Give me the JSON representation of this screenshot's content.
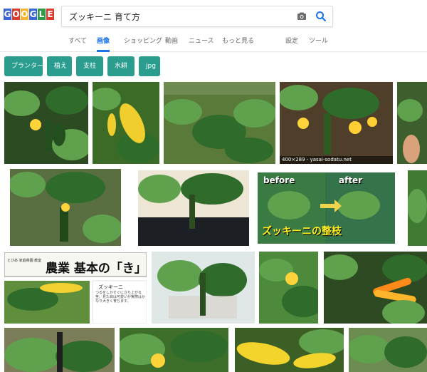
{
  "header": {
    "logo_letters": [
      "G",
      "O",
      "O",
      "G",
      "L",
      "E"
    ],
    "search_value": "ズッキーニ 育て方",
    "tabs": [
      {
        "label": "すべて",
        "active": false
      },
      {
        "label": "画像",
        "active": true
      },
      {
        "label": "ショッピング",
        "active": false
      },
      {
        "label": "動画",
        "active": false
      },
      {
        "label": "ニュース",
        "active": false
      },
      {
        "label": "もっと見る",
        "active": false
      },
      {
        "label": "設定",
        "active": false
      },
      {
        "label": "ツール",
        "active": false
      }
    ]
  },
  "chips": [
    "プランター",
    "植え",
    "支柱",
    "水耕",
    "jpg"
  ],
  "images": {
    "img_03_caption": "400×289 - yasai-sodatu.net",
    "before_label": "before",
    "after_label": "after",
    "pruning_title": "ズッキーニの整枝",
    "farm_label_small": "とびあ 家庭菜園 教室",
    "farm_title": "農業 基本の「き」",
    "zucchini_label": "ズッキーニ",
    "zucchini_desc": "つるをしかすぐに立ち上がる茎。見た目は可愛いが実際はかなり大きく育ちます。"
  },
  "colors": {
    "accent_blue": "#1a73e8",
    "chip_teal": "#2a9d8f"
  }
}
